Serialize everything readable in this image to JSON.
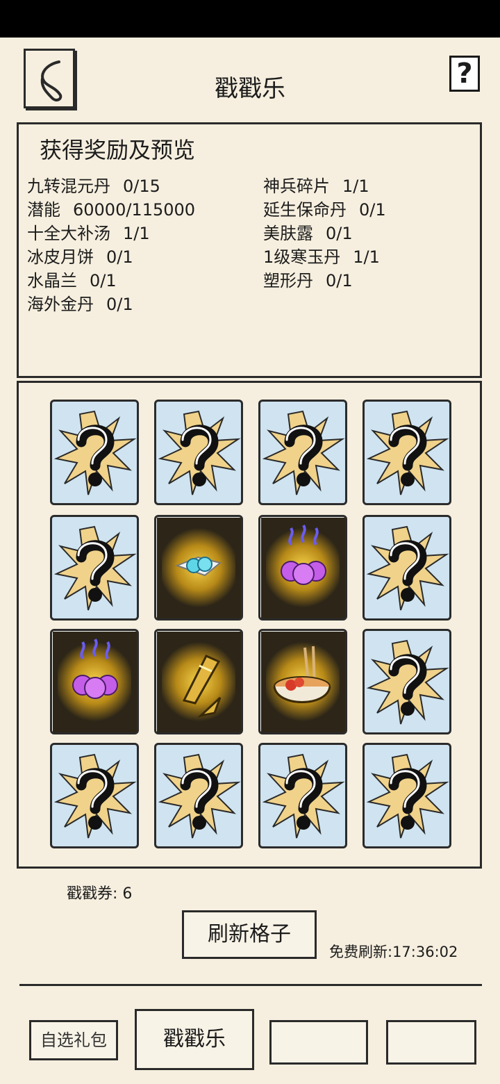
{
  "header": {
    "title": "戳戳乐",
    "back_icon": "back-arrow-icon",
    "help_label": "?"
  },
  "rewards": {
    "heading": "获得奖励及预览",
    "left": [
      {
        "name": "九转混元丹",
        "qty": "0/15"
      },
      {
        "name": "潜能",
        "qty": "60000/115000"
      },
      {
        "name": "十全大补汤",
        "qty": "1/1"
      },
      {
        "name": "冰皮月饼",
        "qty": "0/1"
      },
      {
        "name": "水晶兰",
        "qty": "0/1"
      },
      {
        "name": "海外金丹",
        "qty": "0/1"
      }
    ],
    "right": [
      {
        "name": "神兵碎片",
        "qty": "1/1"
      },
      {
        "name": "延生保命丹",
        "qty": "0/1"
      },
      {
        "name": "美肤露",
        "qty": "0/1"
      },
      {
        "name": "1级寒玉丹",
        "qty": "1/1"
      },
      {
        "name": "塑形丹",
        "qty": "0/1"
      }
    ]
  },
  "grid": {
    "rows": 4,
    "cols": 4,
    "tiles": [
      "hidden",
      "hidden",
      "hidden",
      "hidden",
      "hidden",
      "opened:crystal-orchid-icon",
      "opened:purple-pills-icon",
      "hidden",
      "opened:purple-pills-icon",
      "opened:weapon-shard-icon",
      "opened:tonic-soup-icon",
      "hidden",
      "hidden",
      "hidden",
      "hidden",
      "hidden"
    ]
  },
  "footer": {
    "ticket_label": "戳戳券: 6",
    "refresh_button": "刷新格子",
    "free_refresh": "免费刷新:17:36:02"
  },
  "tabs": {
    "gift_pack": "自选礼包",
    "poke_game": "戳戳乐",
    "empty1": "",
    "empty2": ""
  },
  "colors": {
    "background": "#f6efdf",
    "tile_hidden": "#cfe3f0",
    "burst": "#f0d28a",
    "outline": "#2a2a2a"
  }
}
